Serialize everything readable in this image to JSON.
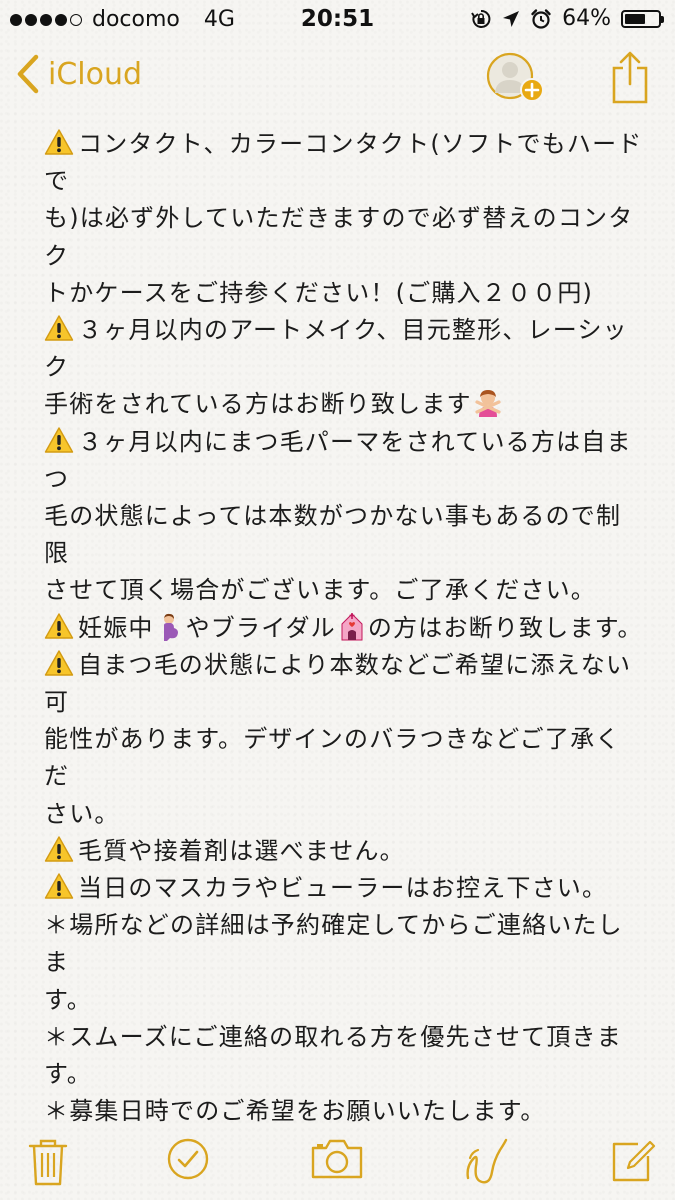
{
  "status_bar": {
    "carrier": "docomo",
    "network": "4G",
    "time": "20:51",
    "battery_level": 0.64,
    "battery_text": "64%"
  },
  "nav": {
    "back_label": "iCloud",
    "accent_color": "#d9a520",
    "icons": [
      "chevron-left-icon",
      "add-person-icon",
      "share-icon"
    ]
  },
  "note": {
    "lines": [
      {
        "warn": true,
        "text": "コンタクト、カラーコンタクト(ソフトでもハードで"
      },
      {
        "warn": false,
        "text": "も)は必ず外していただきますので必ず替えのコンタク"
      },
      {
        "warn": false,
        "text": "トかケースをご持参ください！(ご購入２００円)"
      },
      {
        "warn": true,
        "text": "３ヶ月以内のアートメイク、目元整形、レーシック"
      },
      {
        "warn": false,
        "text": "手術をされている方はお断り致します"
      },
      {
        "warn": true,
        "text": "３ヶ月以内にまつ毛パーマをされている方は自まつ"
      },
      {
        "warn": false,
        "text": "毛の状態によっては本数がつかない事もあるので制限"
      },
      {
        "warn": false,
        "text": "させて頂く場合がございます。ご了承ください。"
      },
      {
        "warn": true,
        "text_a": "妊娠中",
        "text_b": "やブライダル",
        "text_c": "の方はお断り致します。"
      },
      {
        "warn": true,
        "text": "自まつ毛の状態により本数などご希望に添えない可"
      },
      {
        "warn": false,
        "text": "能性があります。デザインのバラつきなどご了承くだ"
      },
      {
        "warn": false,
        "text": "さい。"
      },
      {
        "warn": true,
        "text": "毛質や接着剤は選べません。"
      },
      {
        "warn": true,
        "text": "当日のマスカラやビューラーはお控え下さい。"
      },
      {
        "warn": false,
        "text": "＊場所などの詳細は予約確定してからご連絡いたしま"
      },
      {
        "warn": false,
        "text": "す。"
      },
      {
        "warn": false,
        "text": "＊スムーズにご連絡の取れる方を優先させて頂きま"
      },
      {
        "warn": false,
        "text": "す。"
      },
      {
        "warn": false,
        "text": "＊募集日時でのご希望をお願いいたします。"
      }
    ]
  },
  "toolbar": {
    "icons": [
      "trash-icon",
      "checklist-icon",
      "camera-icon",
      "sketch-icon",
      "compose-icon"
    ]
  }
}
